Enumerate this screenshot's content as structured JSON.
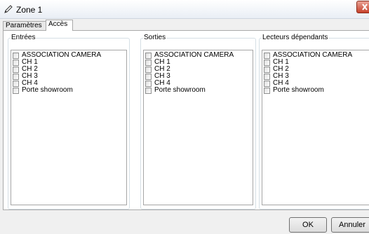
{
  "window": {
    "title": "Zone 1"
  },
  "tabs": [
    {
      "label": "Paramètres",
      "active": false
    },
    {
      "label": "Accès",
      "active": true
    }
  ],
  "groups": [
    {
      "title": "Entrées",
      "items": [
        "ASSOCIATION CAMERA",
        "CH 1",
        "CH 2",
        "CH 3",
        "CH 4",
        "Porte showroom"
      ]
    },
    {
      "title": "Sorties",
      "items": [
        "ASSOCIATION CAMERA",
        "CH 1",
        "CH 2",
        "CH 3",
        "CH 4",
        "Porte showroom"
      ]
    },
    {
      "title": "Lecteurs dépendants",
      "items": [
        "ASSOCIATION CAMERA",
        "CH 1",
        "CH 2",
        "CH 3",
        "CH 4",
        "Porte showroom"
      ]
    }
  ],
  "buttons": {
    "ok": "OK",
    "cancel": "Annuler"
  },
  "icons": {
    "title": "pencil-icon",
    "close": "close-icon",
    "checkbox": "checkbox-icon"
  },
  "colors": {
    "close_button": "#c6412a",
    "group_border": "#d5dfe5"
  }
}
